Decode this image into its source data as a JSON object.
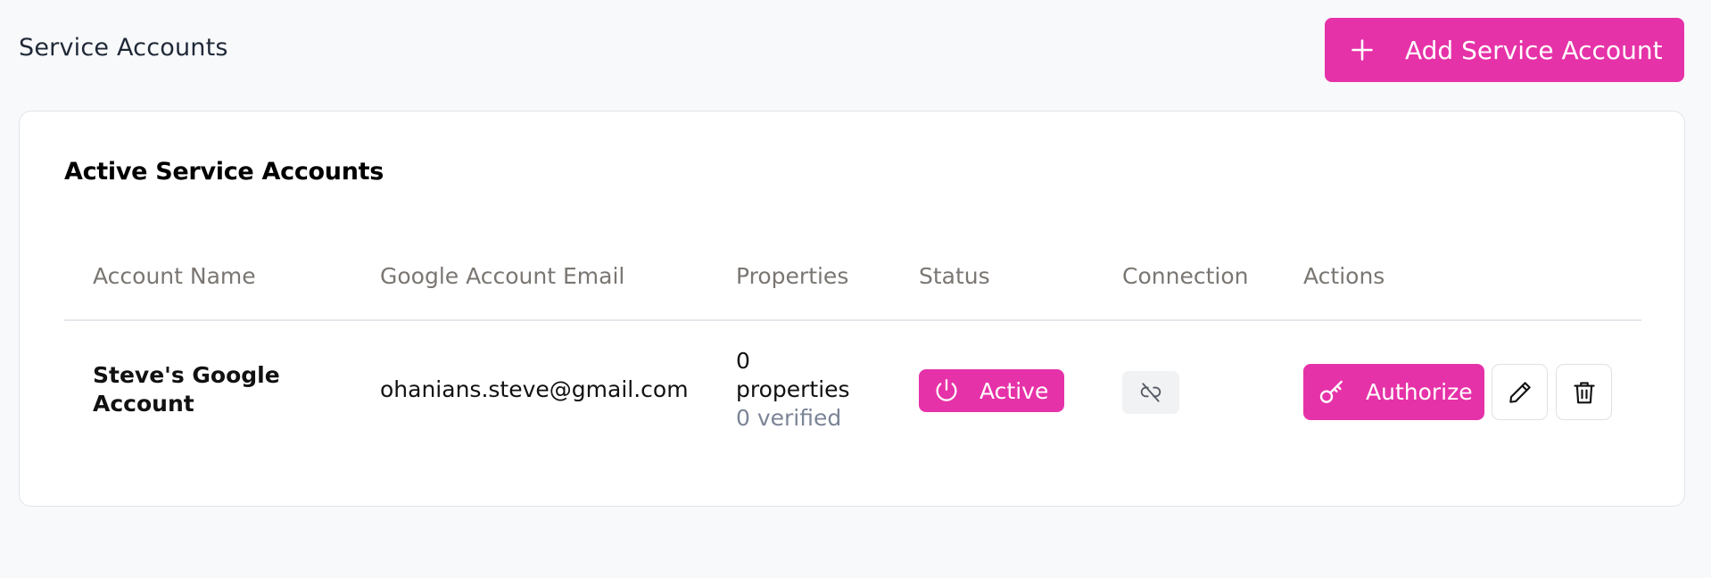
{
  "header": {
    "title": "Service Accounts",
    "add_button_label": "Add Service Account"
  },
  "card": {
    "title": "Active Service Accounts"
  },
  "table": {
    "columns": [
      "Account Name",
      "Google Account Email",
      "Properties",
      "Status",
      "Connection",
      "Actions"
    ],
    "rows": [
      {
        "account_name": "Steve's Google Account",
        "email": "ohanians.steve@gmail.com",
        "properties_count": "0",
        "properties_word": "properties",
        "verified": "0 verified",
        "status": "Active",
        "connection_icon": "unlink-icon",
        "authorize_label": "Authorize"
      }
    ]
  },
  "colors": {
    "accent": "#e632a8",
    "background": "#f8f9fb",
    "card": "#ffffff",
    "header_text": "#7a7672",
    "muted_text": "#7b8496"
  }
}
